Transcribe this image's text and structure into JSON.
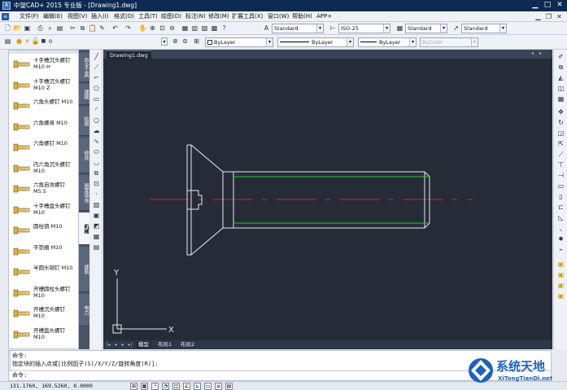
{
  "titlebar": {
    "logo_glyph": "A",
    "title": "中望CAD+ 2015 专业版 - [Drawing1.dwg]",
    "minimize": "▁",
    "maximize": "□",
    "close": "✕"
  },
  "menubar": {
    "items": [
      "文件(F)",
      "编辑(E)",
      "视图(V)",
      "插入(I)",
      "格式(O)",
      "工具(T)",
      "绘图(D)",
      "标注(N)",
      "修改(M)",
      "扩展工具(X)",
      "窗口(W)",
      "帮助(H)",
      "APP+"
    ]
  },
  "toolbar": {
    "textstyle": "Standard",
    "dimstyle": "ISO-25",
    "tablestyle": "Standard",
    "mleaderstyle": "Standard",
    "layer": "0",
    "color": "ByLayer",
    "linetype": "ByLayer",
    "lineweight": "ByLayer",
    "plotstyle": "ByColor"
  },
  "palette": {
    "items": [
      {
        "name": "十字槽沉头螺钉",
        "spec": "M10 H"
      },
      {
        "name": "十字槽沉头螺钉",
        "spec": "M10 Z"
      },
      {
        "name": "六角头螺钉 M10",
        "spec": ""
      },
      {
        "name": "六角螺母 M10",
        "spec": ""
      },
      {
        "name": "六角螺钉 M10",
        "spec": ""
      },
      {
        "name": "内六角沉头螺钉",
        "spec": "M10"
      },
      {
        "name": "六角自攻螺钉",
        "spec": "M5.5"
      },
      {
        "name": "十字槽盘头螺钉",
        "spec": "M10"
      },
      {
        "name": "圆柱销 M10",
        "spec": ""
      },
      {
        "name": "平垫圈 M10",
        "spec": ""
      },
      {
        "name": "半圆头铆钉 M10",
        "spec": ""
      },
      {
        "name": "开槽圆柱头螺钉",
        "spec": "M10"
      },
      {
        "name": "开槽沉头螺钉",
        "spec": "M10"
      },
      {
        "name": "开槽盘头螺钉",
        "spec": "M10"
      }
    ],
    "tabs": [
      "命令工具",
      "建模",
      "绘图",
      "修改",
      "图案填充",
      "机械",
      "建筑",
      "电力"
    ]
  },
  "document": {
    "tab": "Drawing1.dwg",
    "nav_left": "◂",
    "nav_right": "▸",
    "axis_y": "Y",
    "axis_x": "X"
  },
  "layout_tabs": {
    "nav": [
      "|◂",
      "◂",
      "▸",
      "▸|"
    ],
    "tabs": [
      "模型",
      "布局1",
      "布局2"
    ]
  },
  "command": {
    "line1": "命令:",
    "line2": "指定块的插入点或[比例因子(S)/X/Y/Z/旋转角度(R)]:",
    "prompt": "命令:"
  },
  "status": {
    "coords": "131.1760, 169.5260, 0.0000"
  },
  "watermark": {
    "title": "系统天地",
    "url": "XiTongTianDi.net"
  }
}
